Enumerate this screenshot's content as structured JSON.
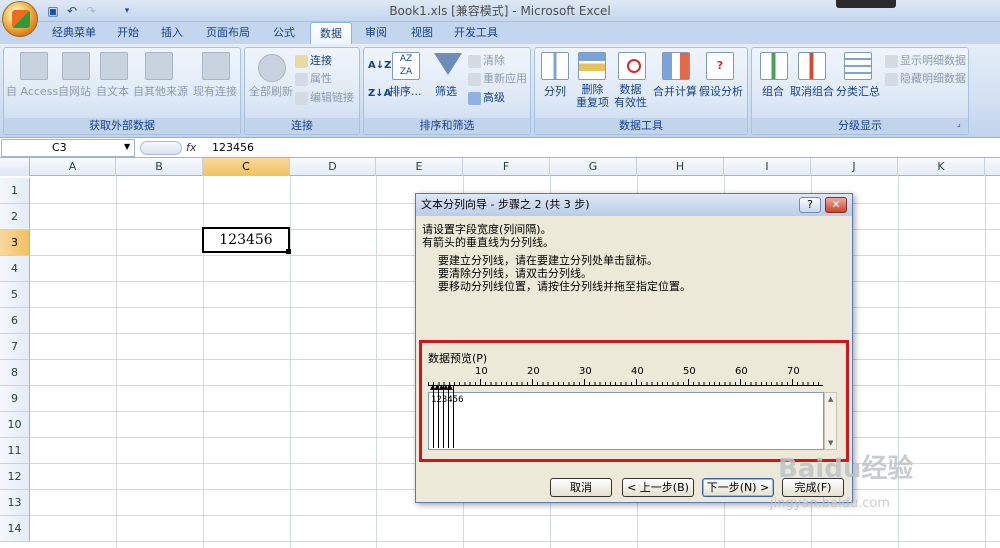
{
  "window": {
    "title": "Book1.xls  [兼容模式] - Microsoft Excel"
  },
  "quick_access": {
    "icons": [
      "save-icon",
      "undo-icon",
      "redo-icon",
      "customize-icon"
    ]
  },
  "tabs": [
    "经典菜单",
    "开始",
    "插入",
    "页面布局",
    "公式",
    "数据",
    "审阅",
    "视图",
    "开发工具"
  ],
  "active_tab": "数据",
  "ribbon": {
    "groups": {
      "external": {
        "label": "获取外部数据",
        "buttons": [
          "自 Access",
          "自网站",
          "自文本",
          "自其他来源",
          "现有连接"
        ]
      },
      "connections": {
        "label": "连接",
        "refresh": "全部刷新",
        "items": [
          "连接",
          "属性",
          "编辑链接"
        ]
      },
      "sort": {
        "label": "排序和筛选",
        "sort": "排序...",
        "filter": "筛选",
        "items": [
          "清除",
          "重新应用",
          "高级"
        ]
      },
      "tools": {
        "label": "数据工具",
        "buttons": [
          "分列",
          "删除\n重复项",
          "数据\n有效性",
          "合并计算",
          "假设分析"
        ]
      },
      "outline": {
        "label": "分级显示",
        "buttons": [
          "组合",
          "取消组合",
          "分类汇总"
        ],
        "items": [
          "显示明细数据",
          "隐藏明细数据"
        ]
      }
    }
  },
  "formula_bar": {
    "name_box": "C3",
    "fx": "fx",
    "formula": "123456"
  },
  "sheet": {
    "columns": [
      "A",
      "B",
      "C",
      "D",
      "E",
      "F",
      "G",
      "H",
      "I",
      "J",
      "K"
    ],
    "rows": [
      "1",
      "2",
      "3",
      "4",
      "5",
      "6",
      "7",
      "8",
      "9",
      "10",
      "11",
      "12",
      "13",
      "14"
    ],
    "selected_cell": "C3",
    "cell_value": "123456"
  },
  "dialog": {
    "title": "文本分列向导 - 步骤之 2 (共 3 步)",
    "line1": "请设置字段宽度(列间隔)。",
    "line2": "有箭头的垂直线为分列线。",
    "instructions": [
      "要建立分列线，请在要建立分列处单击鼠标。",
      "要清除分列线，请双击分列线。",
      "要移动分列线位置，请按住分列线并拖至指定位置。"
    ],
    "preview_label": "数据预览(P)",
    "ruler": [
      "10",
      "20",
      "30",
      "40",
      "50",
      "60",
      "70"
    ],
    "preview_text": "123456",
    "buttons": {
      "cancel": "取消",
      "back": "< 上一步(B)",
      "next": "下一步(N) >",
      "finish": "完成(F)"
    }
  },
  "watermark": {
    "text": "Baidu经验",
    "url": "jingyan.baidu.com"
  },
  "colors": {
    "highlight_border": "#d5131b",
    "ribbon_bg": "#d3e1f2"
  }
}
